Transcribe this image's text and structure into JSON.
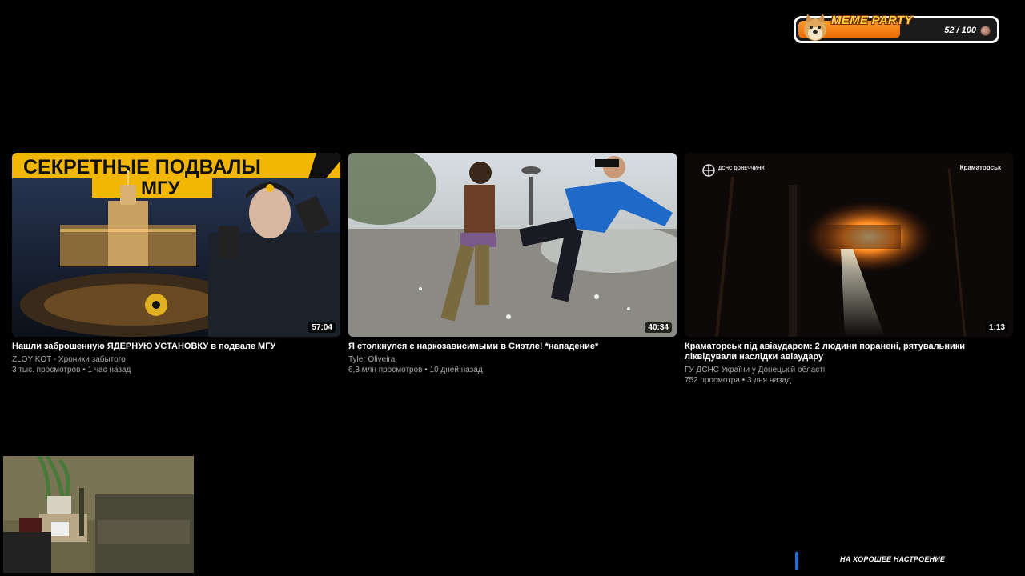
{
  "meme_party": {
    "title": "MEME PARTY",
    "count": "52 / 100",
    "progress_fraction": 0.52,
    "icon": "doge-icon",
    "coin_icon": "coin-icon"
  },
  "videos": [
    {
      "thumb_text_line1": "СЕКРЕТНЫЕ ПОДВАЛЫ",
      "thumb_text_line2": "МГУ",
      "duration": "57:04",
      "title": "Нашли заброшенную ЯДЕРНУЮ УСТАНОВКУ в подвале МГУ",
      "channel": "ZLOY KOT - Хроники забытого",
      "meta": "3 тыс. просмотров • 1 час назад"
    },
    {
      "duration": "40:34",
      "title": "Я столкнулся с наркозависимыми в Сиэтле! *нападение*",
      "channel": "Tyler Oliveira",
      "meta": "6,3 млн просмотров • 10 дней назад"
    },
    {
      "thumb_logo": "ДСНС ДОНЕЧЧИНИ",
      "thumb_location": "Краматорськ",
      "duration": "1:13",
      "title": "Краматорськ під авіаударом: 2 людини поранені, рятувальники ліквідували наслідки авіаудару",
      "channel": "ГУ ДСНС України у Донецькій області",
      "meta": "752 просмотра • 3 дня назад"
    }
  ],
  "ticker": {
    "text": "НА ХОРОШЕЕ НАСТРОЕНИЕ",
    "accent_color": "#1e6fd6"
  },
  "colors": {
    "background": "#000000",
    "meme_fill": "#ff8a1a",
    "meme_title": "#ffd54a"
  }
}
